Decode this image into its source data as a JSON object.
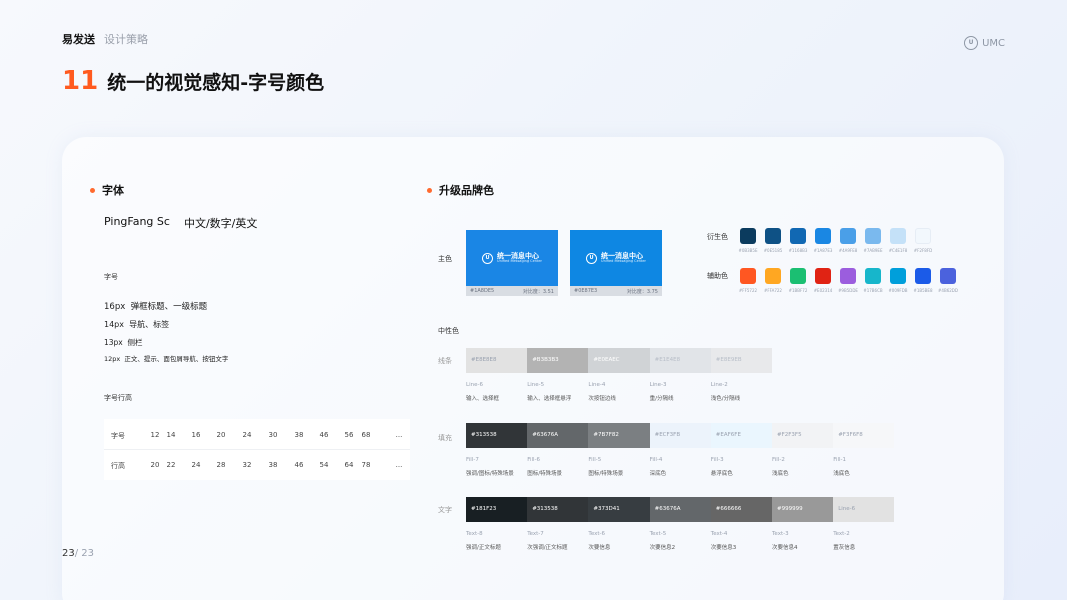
{
  "header": {
    "brand": "易发送",
    "section": "设计策略",
    "logo_mark": "U",
    "logo_text": "UMC"
  },
  "title": {
    "number": "11",
    "text": "统一的视觉感知-字号颜色"
  },
  "page": {
    "current": "23",
    "total": "/ 23"
  },
  "font": {
    "section_title": "字体",
    "family": "PingFang Sc",
    "scripts": "中文/数字/英文",
    "size_label": "字号",
    "sizes": [
      {
        "size": "16px",
        "desc": "弹框标题、一级标题"
      },
      {
        "size": "14px",
        "desc": "导航、标签"
      },
      {
        "size": "13px",
        "desc": "侧栏"
      },
      {
        "size": "12px",
        "desc": "正文、提示、面包屑导航、按钮文字"
      }
    ],
    "line_height_label": "字号行高",
    "table": {
      "row1_label": "字号",
      "row1": [
        "12",
        "14",
        "16",
        "20",
        "24",
        "30",
        "38",
        "46",
        "56",
        "68",
        "..."
      ],
      "row2_label": "行高",
      "row2": [
        "20",
        "22",
        "24",
        "28",
        "32",
        "38",
        "46",
        "54",
        "64",
        "78",
        "..."
      ]
    }
  },
  "brand": {
    "section_title": "升级品牌色",
    "main_label": "主色",
    "main_cards": [
      {
        "logo": "U",
        "name": "统一消息中心",
        "sub": "Unified Messaging Center",
        "hex": "#1A8DE5",
        "ratio": "对比度：3.51",
        "color": "#1a86e5"
      },
      {
        "logo": "U",
        "name": "统一消息中心",
        "sub": "Unified Messaging Center",
        "hex": "#0E87E3",
        "ratio": "对比度：3.75",
        "color": "#0e87e3"
      }
    ],
    "derived_label": "衍生色",
    "derived": [
      {
        "hex": "#0B3B5E",
        "color": "#0b3b5e"
      },
      {
        "hex": "#0E5185",
        "color": "#0e5185"
      },
      {
        "hex": "#1168B3",
        "color": "#1168b3"
      },
      {
        "hex": "#1A87E3",
        "color": "#1a87e3"
      },
      {
        "hex": "#4A9FE8",
        "color": "#4a9fe8"
      },
      {
        "hex": "#7AB9EE",
        "color": "#7ab9ee"
      },
      {
        "hex": "#C4E1F8",
        "color": "#c4e1f8"
      },
      {
        "hex": "#F2F8FD",
        "color": "#f2f8fd"
      }
    ],
    "aux_label": "辅助色",
    "aux": [
      {
        "hex": "#FF5722",
        "color": "#ff5722"
      },
      {
        "hex": "#FFA722",
        "color": "#ffa722"
      },
      {
        "hex": "#1BBF72",
        "color": "#1bbf72"
      },
      {
        "hex": "#E02314",
        "color": "#e02314"
      },
      {
        "hex": "#9B5DDE",
        "color": "#9b5dde"
      },
      {
        "hex": "#17B6CB",
        "color": "#17b6cb"
      },
      {
        "hex": "#009FDB",
        "color": "#009fdb"
      },
      {
        "hex": "#1B5BE8",
        "color": "#1b5be8"
      },
      {
        "hex": "#4B62DD",
        "color": "#4b62dd"
      }
    ],
    "neutral_label": "中性色",
    "line_label": "线条",
    "lines": [
      {
        "hex": "#E8E8E8",
        "name": "Line-6",
        "use": "输入、选择框",
        "color": "#e2e2e2",
        "tc": "#9aa2b0"
      },
      {
        "hex": "#B3B3B3",
        "name": "Line-5",
        "use": "输入、选择框悬浮",
        "color": "#b3b3b3",
        "tc": "#ffffff"
      },
      {
        "hex": "#E0EAEC",
        "name": "Line-4",
        "use": "次按钮边线",
        "color": "#d0d3d6",
        "tc": "#ffffff"
      },
      {
        "hex": "#E1E4E8",
        "name": "Line-3",
        "use": "重/分隔线",
        "color": "#e1e4e8",
        "tc": "#b8bec8"
      },
      {
        "hex": "#E8E9EB",
        "name": "Line-2",
        "use": "浅色/分隔线",
        "color": "#e8e9eb",
        "tc": "#b8bec8"
      }
    ],
    "fill_label": "填充",
    "fills": [
      {
        "hex": "#313538",
        "name": "Fill-7",
        "use": "强调/图标/特殊场景",
        "color": "#313538",
        "tc": "#ffffff"
      },
      {
        "hex": "#63676A",
        "name": "Fill-6",
        "use": "图标/特殊场景",
        "color": "#63676a",
        "tc": "#ffffff"
      },
      {
        "hex": "#7B7F82",
        "name": "Fill-5",
        "use": "图标/特殊场景",
        "color": "#7b7f82",
        "tc": "#ffffff"
      },
      {
        "hex": "#ECF3FB",
        "name": "Fill-4",
        "use": "深底色",
        "color": "#ecf3fb",
        "tc": "#9aa2b0"
      },
      {
        "hex": "#EAF6FE",
        "name": "Fill-3",
        "use": "悬浮底色",
        "color": "#eaf6fe",
        "tc": "#9aa2b0"
      },
      {
        "hex": "#F2F3F5",
        "name": "Fill-2",
        "use": "浅底色",
        "color": "#f2f3f5",
        "tc": "#9aa2b0"
      },
      {
        "hex": "#F3F6F8",
        "name": "Fill-1",
        "use": "浅底色",
        "color": "#f6f7f9",
        "tc": "#9aa2b0"
      }
    ],
    "text_label": "文字",
    "texts": [
      {
        "hex": "#181F23",
        "name": "Text-8",
        "use": "强调/正文标题",
        "color": "#181f23",
        "tc": "#ffffff"
      },
      {
        "hex": "#313538",
        "name": "Text-7",
        "use": "次强调/正文标题",
        "color": "#313538",
        "tc": "#ffffff"
      },
      {
        "hex": "#373D41",
        "name": "Text-6",
        "use": "次要信息",
        "color": "#373d41",
        "tc": "#ffffff"
      },
      {
        "hex": "#63676A",
        "name": "Text-5",
        "use": "次要信息2",
        "color": "#63676a",
        "tc": "#ffffff"
      },
      {
        "hex": "#666666",
        "name": "Text-4",
        "use": "次要信息3",
        "color": "#666666",
        "tc": "#ffffff"
      },
      {
        "hex": "#999999",
        "name": "Text-3",
        "use": "次要信息4",
        "color": "#999999",
        "tc": "#ffffff"
      },
      {
        "hex": "Line-6",
        "name": "Text-2",
        "use": "置灰信息",
        "color": "#e2e2e2",
        "tc": "#9aa2b0"
      }
    ]
  }
}
